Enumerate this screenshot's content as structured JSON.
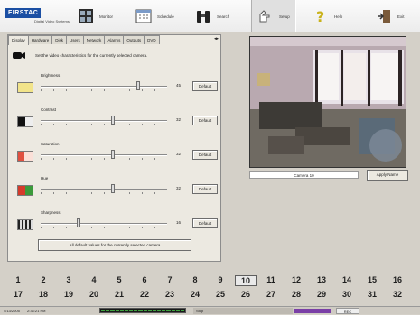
{
  "app": {
    "logo_text": "FIRSTAC",
    "logo_sub": "Digital Video Systems"
  },
  "toolbar": {
    "items": [
      {
        "label": "Monitor",
        "icon": "monitor-grid-icon"
      },
      {
        "label": "Schedule",
        "icon": "calendar-icon"
      },
      {
        "label": "Search",
        "icon": "binoculars-icon"
      },
      {
        "label": "Setup",
        "icon": "setup-hand-icon",
        "selected": true
      },
      {
        "label": "Help",
        "icon": "question-icon"
      },
      {
        "label": "Exit",
        "icon": "exit-door-icon"
      }
    ]
  },
  "panel": {
    "tabs": [
      "Display",
      "Hardware",
      "Disk",
      "Users",
      "Network",
      "Alarms",
      "Outputs",
      "DVD"
    ],
    "active_tab": "Display",
    "intro_text": "Set the video characteristics for the currently selected camera.",
    "sliders": [
      {
        "label": "Brightness",
        "value": "45",
        "level": 0.77,
        "swatch": "#f2e48a",
        "default_label": "Default"
      },
      {
        "label": "Contrast",
        "value": "32",
        "level": 0.57,
        "swatch": "bw",
        "default_label": "Default"
      },
      {
        "label": "Saturation",
        "value": "32",
        "level": 0.57,
        "swatch": "#e05040",
        "default_label": "Default"
      },
      {
        "label": "Hue",
        "value": "32",
        "level": 0.57,
        "swatch": "rg",
        "default_label": "Default"
      },
      {
        "label": "Sharpness",
        "value": "16",
        "level": 0.3,
        "swatch": "stripes",
        "default_label": "Default"
      }
    ],
    "default_all_label": "All default values for the currently selected camera"
  },
  "camera": {
    "caption": "Camera 10",
    "apply_label": "Apply Name"
  },
  "channels": {
    "row1": [
      "1",
      "2",
      "3",
      "4",
      "5",
      "6",
      "7",
      "8",
      "9",
      "10",
      "11",
      "12",
      "13",
      "14",
      "15",
      "16"
    ],
    "row2": [
      "17",
      "18",
      "19",
      "20",
      "21",
      "22",
      "23",
      "24",
      "25",
      "26",
      "27",
      "28",
      "29",
      "30",
      "31",
      "32"
    ],
    "selected": "10"
  },
  "status": {
    "date": "4/13/2005",
    "time": "2:34:21 PM",
    "state": "Stop",
    "rec": "REC"
  },
  "colors": {
    "accent": "#1b4fa3",
    "status_purple": "#7a3fa6",
    "level_green": "#3fa33f"
  }
}
